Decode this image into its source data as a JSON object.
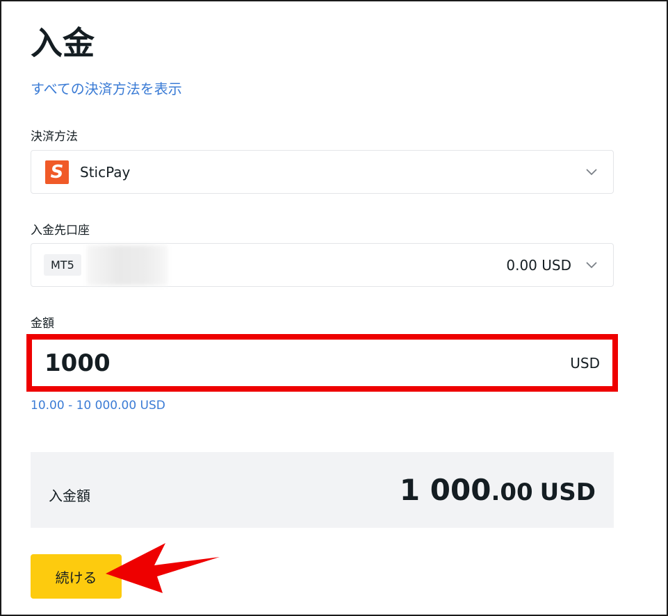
{
  "page": {
    "title": "入金",
    "show_all_methods_link": "すべての決済方法を表示"
  },
  "payment_method": {
    "label": "決済方法",
    "logo_letter": "S",
    "selected": "SticPay",
    "logo_color": "#f05a28"
  },
  "account": {
    "label": "入金先口座",
    "platform_badge": "MT5",
    "balance": "0.00 USD"
  },
  "amount": {
    "label": "金額",
    "value": "1000",
    "currency": "USD",
    "range_hint": "10.00 - 10 000.00 USD"
  },
  "summary": {
    "label": "入金額",
    "value_integer": "1 000",
    "value_decimal": ".00",
    "currency": "USD"
  },
  "actions": {
    "continue_label": "続ける"
  },
  "colors": {
    "accent_yellow": "#fdcb0e",
    "link_blue": "#3a7bd5",
    "highlight_red": "#ee0000"
  },
  "icons": {
    "dropdown": "chevron-down-icon",
    "annotation": "red-arrow-icon"
  }
}
